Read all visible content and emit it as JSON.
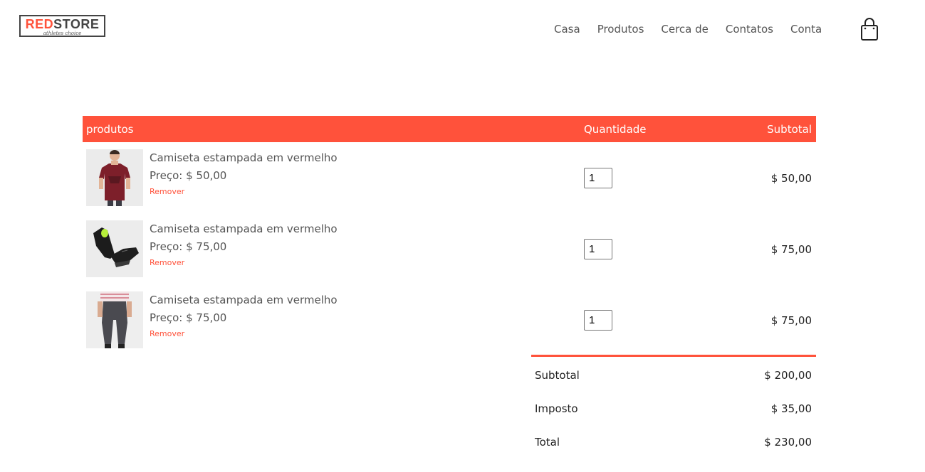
{
  "header": {
    "logo": {
      "part_red": "RED",
      "part_dark": "STORE",
      "tagline": "athletes choice"
    },
    "nav": [
      "Casa",
      "Produtos",
      "Cerca de",
      "Contatos",
      "Conta"
    ],
    "cart_icon": "shopping-bag-icon"
  },
  "cart": {
    "columns": {
      "product": "produtos",
      "quantity": "Quantidade",
      "subtotal": "Subtotal"
    },
    "items": [
      {
        "image": "red-tshirt",
        "name": "Camiseta estampada em vermelho",
        "price": "Preço: $ 50,00",
        "remove": "Remover",
        "quantity": "1",
        "subtotal": "$ 50,00"
      },
      {
        "image": "black-sneakers",
        "name": "Camiseta estampada em vermelho",
        "price": "Preço: $ 75,00",
        "remove": "Remover",
        "quantity": "1",
        "subtotal": "$ 75,00"
      },
      {
        "image": "grey-joggers",
        "name": "Camiseta estampada em vermelho",
        "price": "Preço: $ 75,00",
        "remove": "Remover",
        "quantity": "1",
        "subtotal": "$ 75,00"
      }
    ]
  },
  "totals": {
    "subtotal_label": "Subtotal",
    "subtotal_value": "$ 200,00",
    "tax_label": "Imposto",
    "tax_value": "$ 35,00",
    "total_label": "Total",
    "total_value": "$ 230,00"
  },
  "colors": {
    "accent": "#ff523b",
    "text": "#555555"
  }
}
